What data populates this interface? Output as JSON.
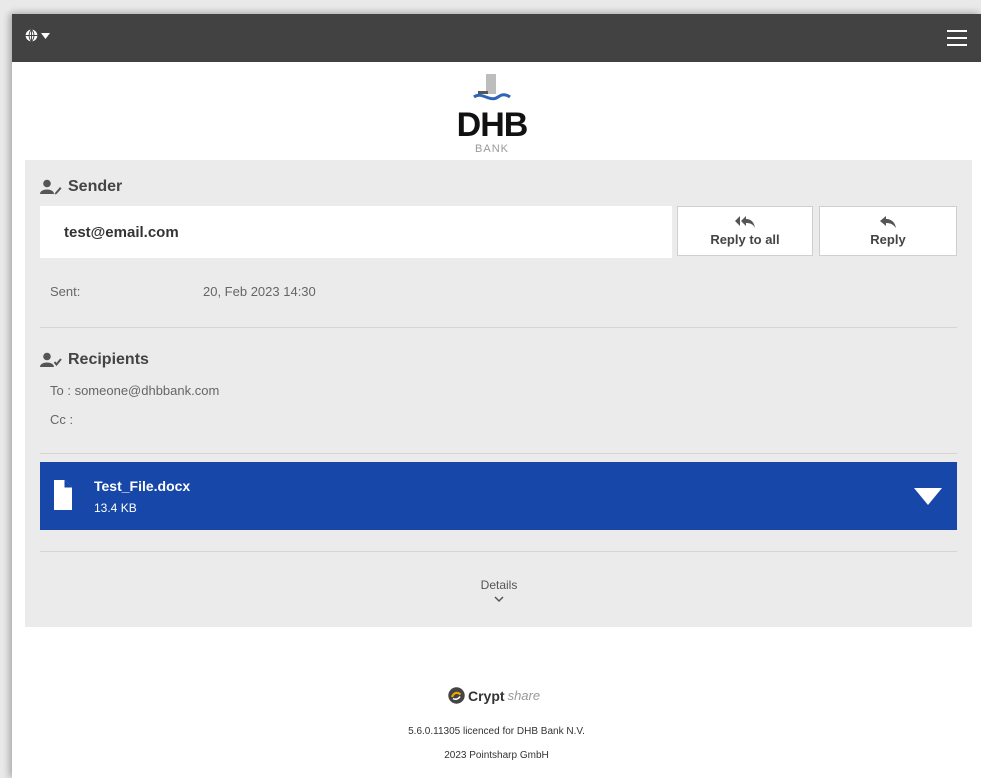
{
  "topbar": {
    "language_icon": "globe-icon",
    "menu_icon": "hamburger-menu-icon"
  },
  "logo": {
    "word": "DHB",
    "sub": "BANK"
  },
  "sender": {
    "title": "Sender",
    "email": "test@email.com",
    "reply_all_label": "Reply to all",
    "reply_label": "Reply",
    "sent_label": "Sent:",
    "sent_value": "20, Feb 2023 14:30"
  },
  "recipients": {
    "title": "Recipients",
    "to": "To : someone@dhbbank.com",
    "cc": "Cc :"
  },
  "attachment": {
    "name": "Test_File.docx",
    "size": "13.4 KB"
  },
  "details_label": "Details",
  "footer": {
    "brand_main": "Crypt",
    "brand_sub": "share",
    "licence": "5.6.0.11305 licenced for DHB Bank N.V.",
    "copyright": "2023 Pointsharp GmbH"
  },
  "colors": {
    "topbar": "#424242",
    "attachment_bar": "#1747a8",
    "panel": "#ebebeb",
    "logo_blue": "#2f64b8"
  }
}
